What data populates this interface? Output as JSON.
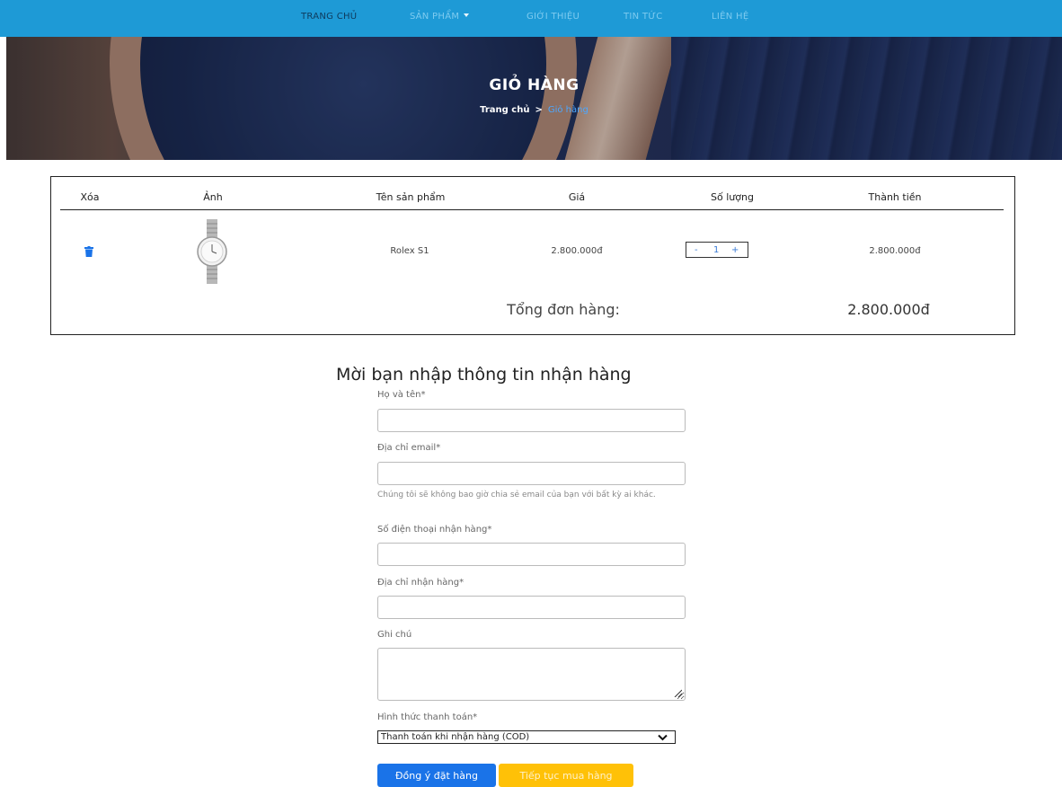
{
  "nav": {
    "items": [
      {
        "label": "Trang chủ"
      },
      {
        "label": "Sản phẩm"
      },
      {
        "label": "Giới thiệu"
      },
      {
        "label": "Tin tức"
      },
      {
        "label": "Liên hệ"
      }
    ]
  },
  "banner": {
    "title": "GIỎ HÀNG",
    "breadcrumb": {
      "home": "Trang chủ",
      "separator": ">",
      "current": "Giỏ hàng"
    }
  },
  "cart": {
    "headers": [
      "Xóa",
      "Ảnh",
      "Tên sản phẩm",
      "Giá",
      "Số lượng",
      "Thành tiền"
    ],
    "items": [
      {
        "name": "Rolex S1",
        "price": "2.800.000đ",
        "qty_minus": "-",
        "quantity": "1",
        "qty_plus": "+",
        "subtotal": "2.800.000đ"
      }
    ],
    "total_label": "Tổng đơn hàng:",
    "total_value": "2.800.000đ"
  },
  "form": {
    "title": "Mời bạn nhập thông tin nhận hàng",
    "name_label": "Họ và tên*",
    "name_value": "",
    "email_label": "Địa chỉ email*",
    "email_value": "",
    "email_hint": "Chúng tôi sẽ không bao giờ chia sẻ email của bạn với bất kỳ ai khác.",
    "phone_label": "Số điện thoại nhận hàng*",
    "phone_value": "",
    "address_label": "Địa chỉ nhận hàng*",
    "address_value": "",
    "note_label": "Ghi chú",
    "note_value": "",
    "payment_label": "Hình thức thanh toán*",
    "payment_selected": "Thanh toán khi nhận hàng (COD)",
    "submit_label": "Đồng ý đặt hàng",
    "continue_label": "Tiếp tục mua hàng"
  },
  "colors": {
    "nav_bg": "#1e9ad6",
    "primary": "#1a73e8",
    "warning": "#ffc107",
    "breadcrumb_active": "#4ca7ff"
  }
}
